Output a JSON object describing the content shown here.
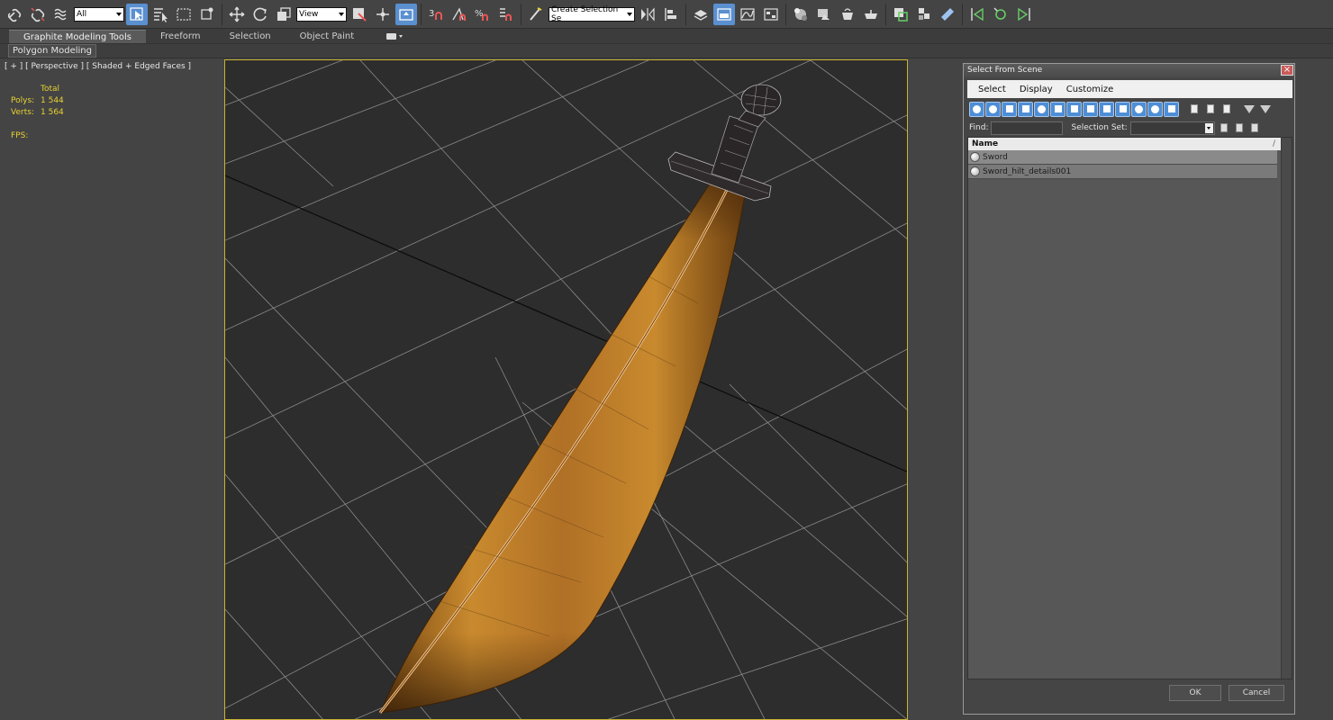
{
  "toolbar": {
    "filter_value": "All",
    "ref_coord_value": "View",
    "named_selection_value": "Create Selection Se"
  },
  "ribbon": {
    "tabs": [
      {
        "label": "Graphite Modeling Tools"
      },
      {
        "label": "Freeform"
      },
      {
        "label": "Selection"
      },
      {
        "label": "Object Paint"
      }
    ],
    "panel_label": "Polygon Modeling"
  },
  "viewport": {
    "label": "[ + ] [ Perspective ] [ Shaded + Edged Faces ]",
    "stats": {
      "total_header": "Total",
      "polys_label": "Polys:",
      "polys_value": "1 544",
      "verts_label": "Verts:",
      "verts_value": "1 564",
      "fps_label": "FPS:"
    }
  },
  "dialog": {
    "title": "Select From Scene",
    "close_glyph": "×",
    "menu": [
      "Select",
      "Display",
      "Customize"
    ],
    "find_label": "Find:",
    "find_value": "",
    "selection_set_label": "Selection Set:",
    "column_name": "Name",
    "column_sort_glyph": "/",
    "items": [
      {
        "name": "Sword"
      },
      {
        "name": "Sword_hilt_details001"
      }
    ],
    "ok_label": "OK",
    "cancel_label": "Cancel"
  },
  "colors": {
    "accent": "#5a8fd0",
    "viewport_border": "#c8b432",
    "stats_text": "#e8d232",
    "blade": "#c07a24"
  }
}
